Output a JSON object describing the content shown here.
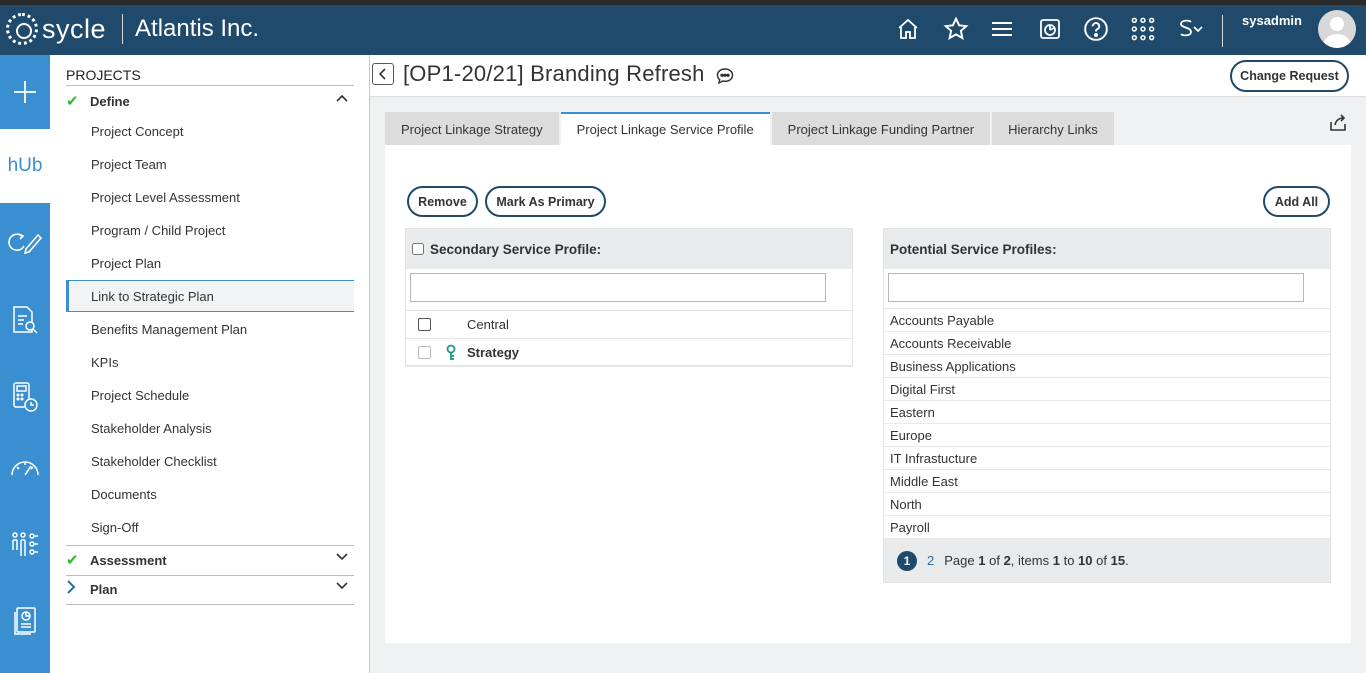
{
  "header": {
    "logo_text": "sycle",
    "company": "Atlantis Inc.",
    "icons": [
      "home-icon",
      "star-icon",
      "menu-icon",
      "dashboard-icon",
      "help-icon",
      "apps-grid-icon",
      "switch-icon"
    ],
    "username": "sysadmin"
  },
  "rail": {
    "hub_label": "hUb",
    "items": [
      "plus-icon",
      "hub-logo",
      "edit-cycle-icon",
      "document-search-icon",
      "calculator-clock-icon",
      "gauge-icon",
      "people-settings-icon",
      "report-icon"
    ]
  },
  "nav": {
    "title": "PROJECTS",
    "define_label": "Define",
    "items": [
      "Project Concept",
      "Project Team",
      "Project Level Assessment",
      "Program / Child Project",
      "Project Plan",
      "Link to Strategic Plan",
      "Benefits Management Plan",
      "KPIs",
      "Project Schedule",
      "Stakeholder Analysis",
      "Stakeholder Checklist",
      "Documents",
      "Sign-Off"
    ],
    "assessment_label": "Assessment",
    "plan_label": "Plan"
  },
  "main": {
    "title": "[OP1-20/21] Branding Refresh",
    "change_request": "Change Request",
    "tabs": [
      "Project Linkage Strategy",
      "Project Linkage Service Profile",
      "Project Linkage Funding Partner",
      "Hierarchy Links"
    ],
    "remove_label": "Remove",
    "mark_primary_label": "Mark As Primary",
    "add_all_label": "Add All",
    "secondary": {
      "header": "Secondary Service Profile:",
      "rows": [
        "Central",
        "Strategy"
      ]
    },
    "potential": {
      "header": "Potential Service Profiles:",
      "rows": [
        "Accounts Payable",
        "Accounts Receivable",
        "Business Applications",
        "Digital First",
        "Eastern",
        "Europe",
        "IT Infrastucture",
        "Middle East",
        "North",
        "Payroll"
      ]
    },
    "pager": {
      "current": "1",
      "next": "2",
      "text_page": "Page",
      "page": "1",
      "text_of": "of",
      "pages": "2",
      "text_items": ", items",
      "from": "1",
      "text_to": "to",
      "to": "10",
      "text_of2": "of",
      "total": "15",
      "text_end": "."
    }
  },
  "colors": {
    "header_bg": "#1f4a6b",
    "rail_bg": "#3a8fd1",
    "check_green": "#2eb82e"
  }
}
